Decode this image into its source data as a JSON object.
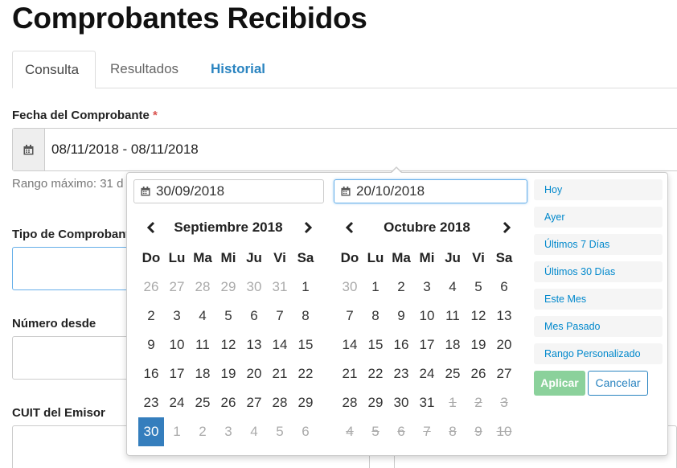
{
  "page": {
    "title": "Comprobantes Recibidos"
  },
  "tabs": [
    {
      "label": "Consulta"
    },
    {
      "label": "Resultados"
    },
    {
      "label": "Historial"
    }
  ],
  "form": {
    "date_label": "Fecha del Comprobante",
    "required_mark": "*",
    "date_value": "08/11/2018 - 08/11/2018",
    "date_hint": "Rango máximo: 31 d",
    "tipo_label": "Tipo de Comprobant",
    "numero_label": "Número desde",
    "cuit_label": "CUIT del Emisor"
  },
  "picker": {
    "start_input": "30/09/2018",
    "end_input": "20/10/2018",
    "left_title": "Septiembre 2018",
    "right_title": "Octubre 2018",
    "weekdays": [
      "Do",
      "Lu",
      "Ma",
      "Mi",
      "Ju",
      "Vi",
      "Sa"
    ],
    "left_days": [
      [
        "26",
        "27",
        "28",
        "29",
        "30",
        "31",
        "1"
      ],
      [
        "2",
        "3",
        "4",
        "5",
        "6",
        "7",
        "8"
      ],
      [
        "9",
        "10",
        "11",
        "12",
        "13",
        "14",
        "15"
      ],
      [
        "16",
        "17",
        "18",
        "19",
        "20",
        "21",
        "22"
      ],
      [
        "23",
        "24",
        "25",
        "26",
        "27",
        "28",
        "29"
      ],
      [
        "30",
        "1",
        "2",
        "3",
        "4",
        "5",
        "6"
      ]
    ],
    "right_days": [
      [
        "30",
        "1",
        "2",
        "3",
        "4",
        "5",
        "6"
      ],
      [
        "7",
        "8",
        "9",
        "10",
        "11",
        "12",
        "13"
      ],
      [
        "14",
        "15",
        "16",
        "17",
        "18",
        "19",
        "20"
      ],
      [
        "21",
        "22",
        "23",
        "24",
        "25",
        "26",
        "27"
      ],
      [
        "28",
        "29",
        "30",
        "31",
        "1",
        "2",
        "3"
      ],
      [
        "4",
        "5",
        "6",
        "7",
        "8",
        "9",
        "10"
      ]
    ],
    "ranges": [
      "Hoy",
      "Ayer",
      "Últimos 7 Días",
      "Últimos 30 Días",
      "Este Mes",
      "Mes Pasado",
      "Rango Personalizado"
    ],
    "apply_label": "Aplicar",
    "cancel_label": "Cancelar",
    "selected_color": "#357ebd",
    "apply_color": "#8bd19b"
  }
}
